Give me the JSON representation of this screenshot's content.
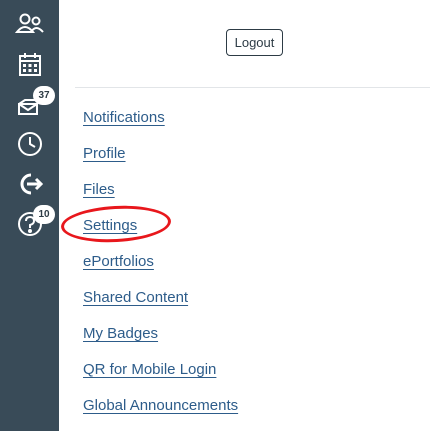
{
  "header": {
    "logout_label": "Logout"
  },
  "global_nav": {
    "items": [
      {
        "icon": "account-icon"
      },
      {
        "icon": "calendar-icon"
      },
      {
        "icon": "inbox-icon",
        "badge": "37"
      },
      {
        "icon": "history-icon"
      },
      {
        "icon": "commons-icon"
      },
      {
        "icon": "help-icon",
        "badge": "10"
      }
    ]
  },
  "account_menu": {
    "items": [
      {
        "label": "Notifications"
      },
      {
        "label": "Profile"
      },
      {
        "label": "Files"
      },
      {
        "label": "Settings"
      },
      {
        "label": "ePortfolios"
      },
      {
        "label": "Shared Content"
      },
      {
        "label": "My Badges"
      },
      {
        "label": "QR for Mobile Login"
      },
      {
        "label": "Global Announcements"
      }
    ]
  },
  "colors": {
    "nav_background": "#394b58",
    "link": "#2d5c8a",
    "highlight": "#e8171c"
  }
}
